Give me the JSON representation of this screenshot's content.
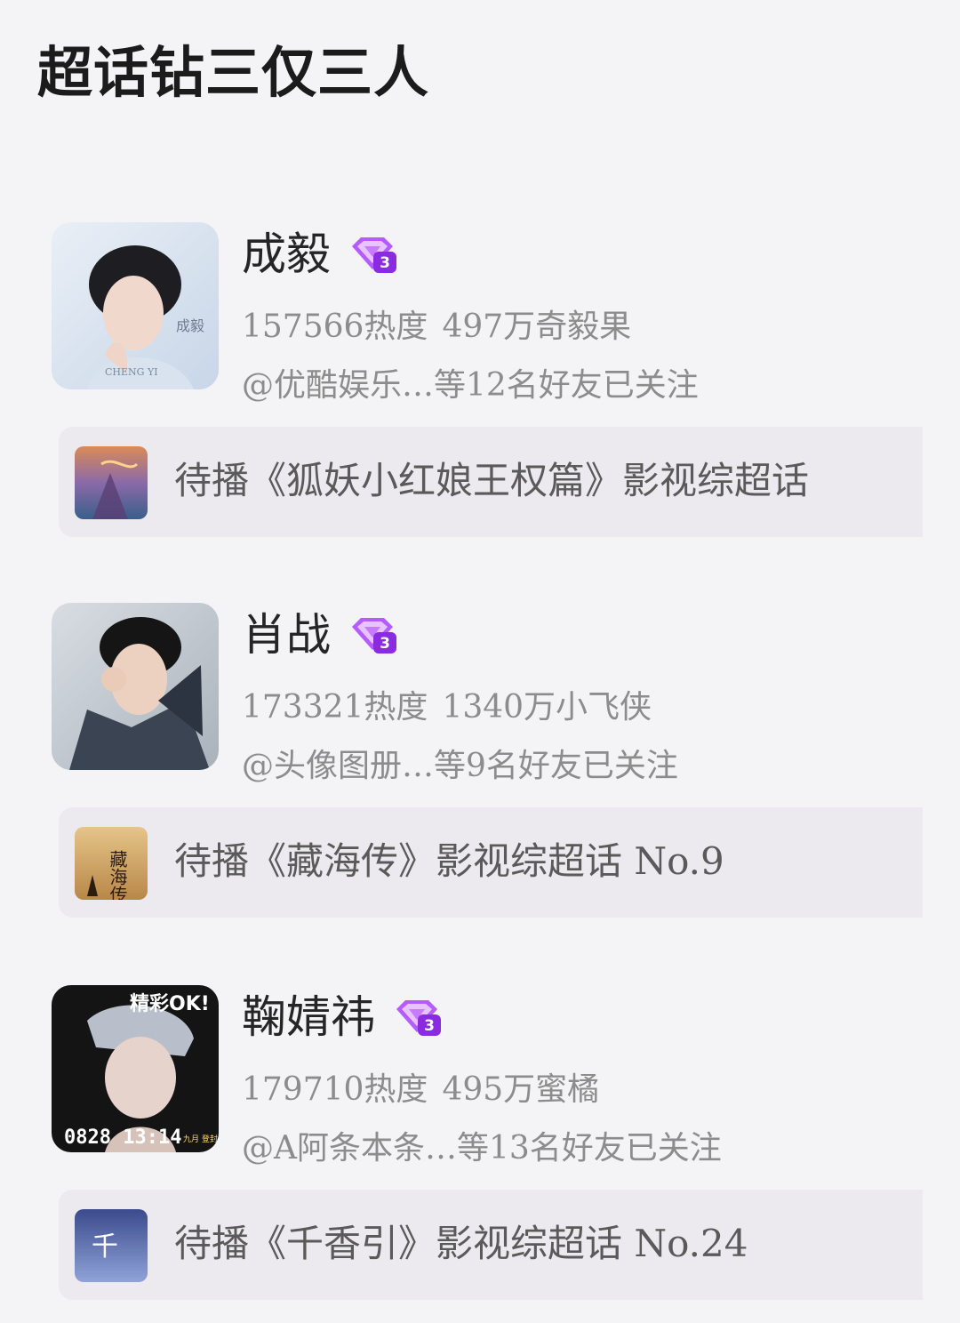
{
  "page": {
    "title": "超话钻三仅三人"
  },
  "entries": [
    {
      "name": "成毅",
      "heat": "157566热度",
      "fans": "497万奇毅果",
      "friends": "@优酷娱乐…等12名好友已关注",
      "show": "待播《狐妖小红娘王权篇》影视综超话",
      "avatar_text": [
        "成毅",
        "CHENG YI"
      ],
      "thumb_text": ""
    },
    {
      "name": "肖战",
      "heat": "173321热度",
      "fans": "1340万小飞侠",
      "friends": "@头像图册…等9名好友已关注",
      "show": "待播《藏海传》影视综超话 No.9",
      "avatar_text": [],
      "thumb_text": "藏海传"
    },
    {
      "name": "鞠婧祎",
      "heat": "179710热度",
      "fans": "495万蜜橘",
      "friends": "@A阿条本条…等13名好友已关注",
      "show": "待播《千香引》影视综超话 No.24",
      "avatar_text": [
        "精彩OK!",
        "0828 13:14",
        "九月 登封"
      ],
      "thumb_text": "千"
    }
  ],
  "badge_icon": "super-topic-diamond-badge-icon",
  "colors": {
    "badge_purple": "#a24dff",
    "badge_pink": "#ff7ad9",
    "meta_gray": "#8c8c8c"
  }
}
